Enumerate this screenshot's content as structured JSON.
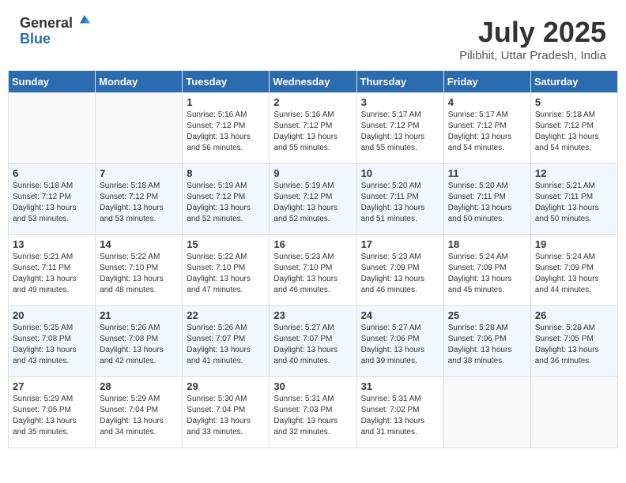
{
  "header": {
    "logo_general": "General",
    "logo_blue": "Blue",
    "month_title": "July 2025",
    "location": "Pilibhit, Uttar Pradesh, India"
  },
  "days_of_week": [
    "Sunday",
    "Monday",
    "Tuesday",
    "Wednesday",
    "Thursday",
    "Friday",
    "Saturday"
  ],
  "weeks": [
    [
      {
        "day": "",
        "info": ""
      },
      {
        "day": "",
        "info": ""
      },
      {
        "day": "1",
        "info": "Sunrise: 5:16 AM\nSunset: 7:12 PM\nDaylight: 13 hours and 56 minutes."
      },
      {
        "day": "2",
        "info": "Sunrise: 5:16 AM\nSunset: 7:12 PM\nDaylight: 13 hours and 55 minutes."
      },
      {
        "day": "3",
        "info": "Sunrise: 5:17 AM\nSunset: 7:12 PM\nDaylight: 13 hours and 55 minutes."
      },
      {
        "day": "4",
        "info": "Sunrise: 5:17 AM\nSunset: 7:12 PM\nDaylight: 13 hours and 54 minutes."
      },
      {
        "day": "5",
        "info": "Sunrise: 5:18 AM\nSunset: 7:12 PM\nDaylight: 13 hours and 54 minutes."
      }
    ],
    [
      {
        "day": "6",
        "info": "Sunrise: 5:18 AM\nSunset: 7:12 PM\nDaylight: 13 hours and 53 minutes."
      },
      {
        "day": "7",
        "info": "Sunrise: 5:18 AM\nSunset: 7:12 PM\nDaylight: 13 hours and 53 minutes."
      },
      {
        "day": "8",
        "info": "Sunrise: 5:19 AM\nSunset: 7:12 PM\nDaylight: 13 hours and 52 minutes."
      },
      {
        "day": "9",
        "info": "Sunrise: 5:19 AM\nSunset: 7:12 PM\nDaylight: 13 hours and 52 minutes."
      },
      {
        "day": "10",
        "info": "Sunrise: 5:20 AM\nSunset: 7:11 PM\nDaylight: 13 hours and 51 minutes."
      },
      {
        "day": "11",
        "info": "Sunrise: 5:20 AM\nSunset: 7:11 PM\nDaylight: 13 hours and 50 minutes."
      },
      {
        "day": "12",
        "info": "Sunrise: 5:21 AM\nSunset: 7:11 PM\nDaylight: 13 hours and 50 minutes."
      }
    ],
    [
      {
        "day": "13",
        "info": "Sunrise: 5:21 AM\nSunset: 7:11 PM\nDaylight: 13 hours and 49 minutes."
      },
      {
        "day": "14",
        "info": "Sunrise: 5:22 AM\nSunset: 7:10 PM\nDaylight: 13 hours and 48 minutes."
      },
      {
        "day": "15",
        "info": "Sunrise: 5:22 AM\nSunset: 7:10 PM\nDaylight: 13 hours and 47 minutes."
      },
      {
        "day": "16",
        "info": "Sunrise: 5:23 AM\nSunset: 7:10 PM\nDaylight: 13 hours and 46 minutes."
      },
      {
        "day": "17",
        "info": "Sunrise: 5:23 AM\nSunset: 7:09 PM\nDaylight: 13 hours and 46 minutes."
      },
      {
        "day": "18",
        "info": "Sunrise: 5:24 AM\nSunset: 7:09 PM\nDaylight: 13 hours and 45 minutes."
      },
      {
        "day": "19",
        "info": "Sunrise: 5:24 AM\nSunset: 7:09 PM\nDaylight: 13 hours and 44 minutes."
      }
    ],
    [
      {
        "day": "20",
        "info": "Sunrise: 5:25 AM\nSunset: 7:08 PM\nDaylight: 13 hours and 43 minutes."
      },
      {
        "day": "21",
        "info": "Sunrise: 5:26 AM\nSunset: 7:08 PM\nDaylight: 13 hours and 42 minutes."
      },
      {
        "day": "22",
        "info": "Sunrise: 5:26 AM\nSunset: 7:07 PM\nDaylight: 13 hours and 41 minutes."
      },
      {
        "day": "23",
        "info": "Sunrise: 5:27 AM\nSunset: 7:07 PM\nDaylight: 13 hours and 40 minutes."
      },
      {
        "day": "24",
        "info": "Sunrise: 5:27 AM\nSunset: 7:06 PM\nDaylight: 13 hours and 39 minutes."
      },
      {
        "day": "25",
        "info": "Sunrise: 5:28 AM\nSunset: 7:06 PM\nDaylight: 13 hours and 38 minutes."
      },
      {
        "day": "26",
        "info": "Sunrise: 5:28 AM\nSunset: 7:05 PM\nDaylight: 13 hours and 36 minutes."
      }
    ],
    [
      {
        "day": "27",
        "info": "Sunrise: 5:29 AM\nSunset: 7:05 PM\nDaylight: 13 hours and 35 minutes."
      },
      {
        "day": "28",
        "info": "Sunrise: 5:29 AM\nSunset: 7:04 PM\nDaylight: 13 hours and 34 minutes."
      },
      {
        "day": "29",
        "info": "Sunrise: 5:30 AM\nSunset: 7:04 PM\nDaylight: 13 hours and 33 minutes."
      },
      {
        "day": "30",
        "info": "Sunrise: 5:31 AM\nSunset: 7:03 PM\nDaylight: 13 hours and 32 minutes."
      },
      {
        "day": "31",
        "info": "Sunrise: 5:31 AM\nSunset: 7:02 PM\nDaylight: 13 hours and 31 minutes."
      },
      {
        "day": "",
        "info": ""
      },
      {
        "day": "",
        "info": ""
      }
    ]
  ]
}
